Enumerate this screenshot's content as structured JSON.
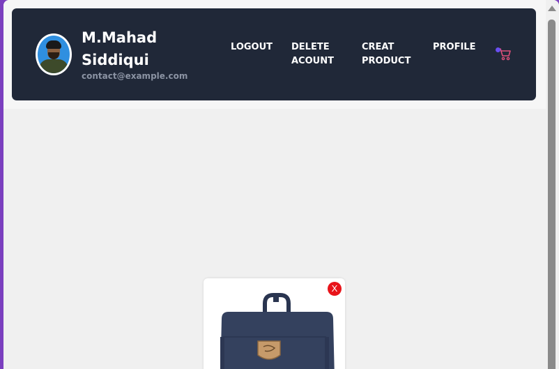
{
  "user": {
    "name": "M.Mahad Siddiqui",
    "email": "contact@example.com"
  },
  "nav": {
    "logout": "LOGOUT",
    "delete_account": "DELETE ACOUNT",
    "create_product": "CREAT PRODUCT",
    "profile": "PROFILE"
  },
  "icons": {
    "cart": "shopping-cart-icon",
    "remove": "close-icon"
  },
  "product_card": {
    "remove_label": "X"
  },
  "colors": {
    "navbar": "#202838",
    "remove_button": "#e8141a",
    "cart": "#e0507a"
  }
}
